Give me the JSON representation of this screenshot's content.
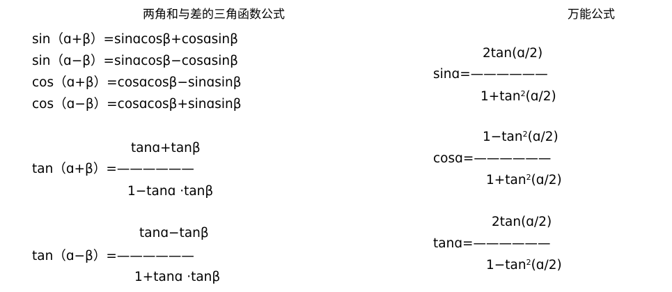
{
  "left": {
    "heading": "两角和与差的三角函数公式",
    "formulas": [
      "sin（ɑ+β）=sinɑcosβ+cosɑsinβ",
      "sin（ɑ−β）=sinɑcosβ−cosɑsinβ",
      "cos（ɑ+β）=cosɑcosβ−sinɑsinβ",
      "cos（ɑ−β）=cosɑcosβ+sinɑsinβ"
    ],
    "tan_sum": {
      "numerator": "tanɑ+tanβ",
      "lhs": "tan（ɑ+β）=——————",
      "denominator": "1−tanɑ ·tanβ"
    },
    "tan_diff": {
      "numerator": "tanɑ−tanβ",
      "lhs": "tan（ɑ−β）=——————",
      "denominator": "1+tanɑ ·tanβ"
    }
  },
  "right": {
    "heading": "万能公式",
    "sin": {
      "numerator": "2tan(ɑ/2)",
      "lhs": "sinɑ=——————",
      "den_prefix": "1+tan",
      "den_exp": "2",
      "den_suffix": "(ɑ/2)"
    },
    "cos": {
      "num_prefix": "1−tan",
      "num_exp": "2",
      "num_suffix": "(ɑ/2)",
      "lhs": "cosɑ=——————",
      "den_prefix": "1+tan",
      "den_exp": "2",
      "den_suffix": "(ɑ/2)"
    },
    "tan": {
      "numerator": "2tan(ɑ/2)",
      "lhs": "tanɑ=——————",
      "den_prefix": "1−tan",
      "den_exp": "2",
      "den_suffix": "(ɑ/2)"
    }
  }
}
